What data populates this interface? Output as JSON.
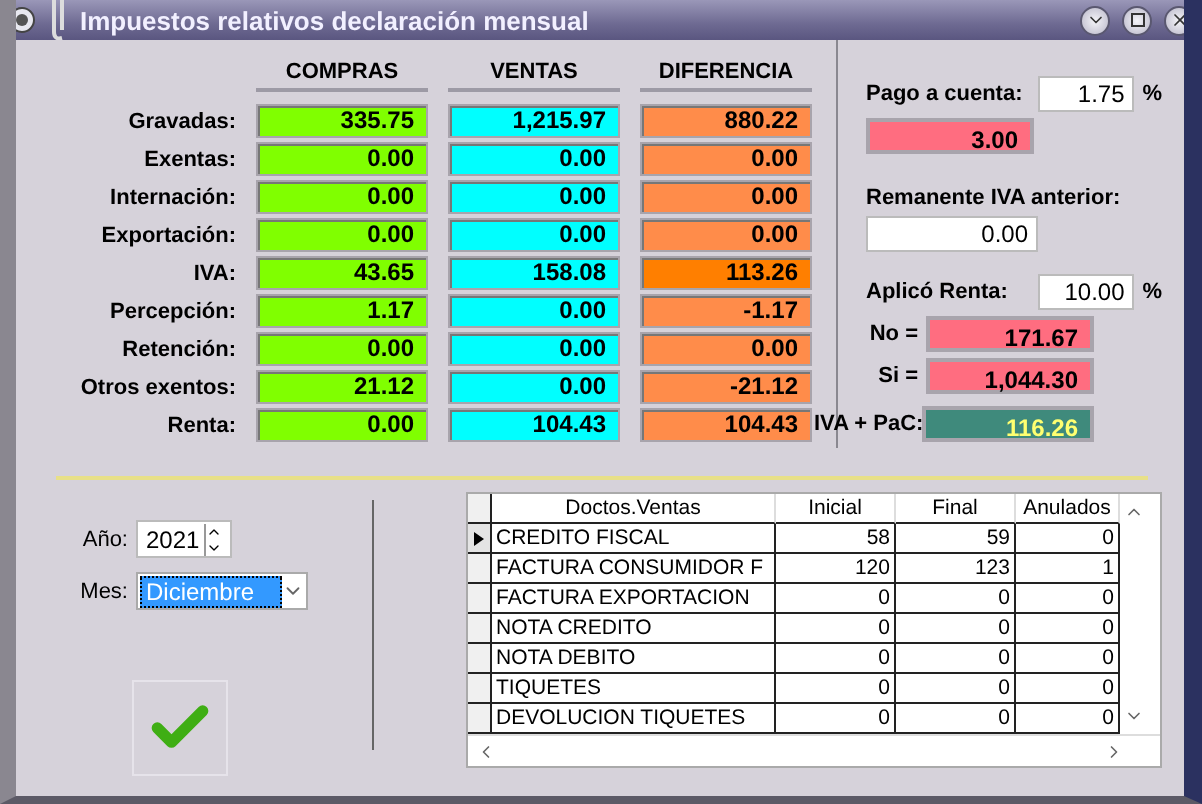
{
  "window": {
    "title": "Impuestos relativos declaración mensual"
  },
  "summary": {
    "columns": [
      {
        "label": "COMPRAS",
        "color": "#80ff00"
      },
      {
        "label": "VENTAS",
        "color": "#00ffff"
      },
      {
        "label": "DIFERENCIA",
        "color": "#ff8c4a"
      }
    ],
    "rows": [
      {
        "label": "Gravadas:",
        "values": [
          "335.75",
          "1,215.97",
          "880.22"
        ],
        "highlighted": false
      },
      {
        "label": "Exentas:",
        "values": [
          "0.00",
          "0.00",
          "0.00"
        ],
        "highlighted": false
      },
      {
        "label": "Internación:",
        "values": [
          "0.00",
          "0.00",
          "0.00"
        ],
        "highlighted": false
      },
      {
        "label": "Exportación:",
        "values": [
          "0.00",
          "0.00",
          "0.00"
        ],
        "highlighted": false
      },
      {
        "label": "IVA:",
        "values": [
          "43.65",
          "158.08",
          "113.26"
        ],
        "highlighted": true
      },
      {
        "label": "Percepción:",
        "values": [
          "1.17",
          "0.00",
          "-1.17"
        ],
        "highlighted": false
      },
      {
        "label": "Retención:",
        "values": [
          "0.00",
          "0.00",
          "0.00"
        ],
        "highlighted": false
      },
      {
        "label": "Otros exentos:",
        "values": [
          "21.12",
          "0.00",
          "-21.12"
        ],
        "highlighted": false
      },
      {
        "label": "Renta:",
        "values": [
          "0.00",
          "104.43",
          "104.43"
        ],
        "highlighted": false
      }
    ]
  },
  "pago_a_cuenta": {
    "label": "Pago a cuenta:",
    "rate": "1.75",
    "unit": "%",
    "result": "3.00"
  },
  "remanente": {
    "label": "Remanente IVA anterior:",
    "value": "0.00"
  },
  "renta": {
    "label": "Aplicó Renta:",
    "rate": "10.00",
    "unit": "%",
    "no_label": "No =",
    "no_value": "171.67",
    "si_label": "Si =",
    "si_value": "1,044.30"
  },
  "iva_pac": {
    "label": "IVA + PaC:",
    "value": "116.26"
  },
  "period": {
    "year_label": "Año:",
    "year": "2021",
    "month_label": "Mes:",
    "month": "Diciembre"
  },
  "docs": {
    "columns": [
      "Doctos.Ventas",
      "Inicial",
      "Final",
      "Anulados"
    ],
    "rows": [
      {
        "cells": [
          "CREDITO FISCAL",
          "58",
          "59",
          "0"
        ],
        "selected": true
      },
      {
        "cells": [
          "FACTURA CONSUMIDOR F",
          "120",
          "123",
          "1"
        ],
        "selected": false
      },
      {
        "cells": [
          "FACTURA EXPORTACION",
          "0",
          "0",
          "0"
        ],
        "selected": false
      },
      {
        "cells": [
          "NOTA CREDITO",
          "0",
          "0",
          "0"
        ],
        "selected": false
      },
      {
        "cells": [
          "NOTA DEBITO",
          "0",
          "0",
          "0"
        ],
        "selected": false
      },
      {
        "cells": [
          "TIQUETES",
          "0",
          "0",
          "0"
        ],
        "selected": false
      },
      {
        "cells": [
          "DEVOLUCION TIQUETES",
          "0",
          "0",
          "0"
        ],
        "selected": false
      }
    ]
  }
}
